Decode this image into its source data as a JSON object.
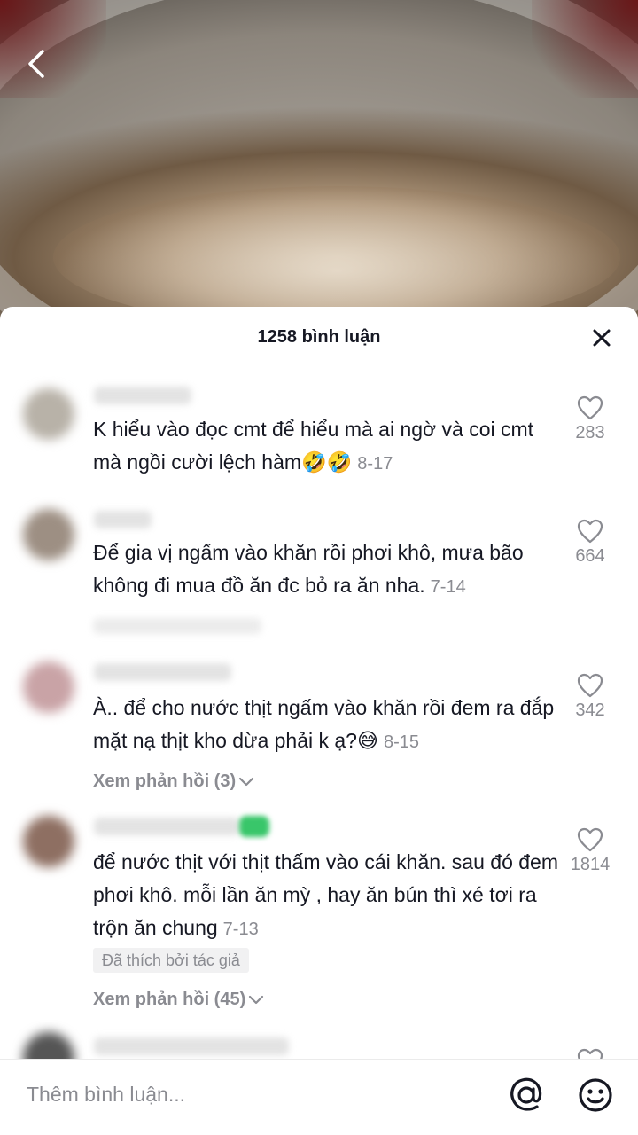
{
  "comments_sheet": {
    "title": "1258 bình luận",
    "close_icon": "close-icon"
  },
  "comments": [
    {
      "text": "K hiểu vào đọc cmt để hiểu mà ai ngờ và coi cmt mà ngồi cười lệch hàm🤣🤣",
      "date": "8-17",
      "likes": "283"
    },
    {
      "text": "Để gia vị ngấm vào khăn rồi phơi khô, mưa bão không đi mua đồ ăn đc bỏ ra ăn nha.",
      "date": "7-14",
      "likes": "664"
    },
    {
      "text": "À.. để cho nước thịt ngấm vào khăn rồi đem ra đắp mặt nạ thịt kho dừa phải k ạ?😅",
      "date": "8-15",
      "likes": "342",
      "replies": "Xem phản hồi (3)"
    },
    {
      "text": "để nước thịt với thịt thấm vào cái khăn. sau đó đem phơi khô. mỗi lần ăn mỳ , hay ăn bún thì xé tơi ra trộn ăn chung",
      "date": "7-13",
      "likes": "1814",
      "badge": "Đã thích bởi tác giả",
      "replies": "Xem phản hồi (45)"
    }
  ],
  "input": {
    "placeholder": "Thêm bình luận..."
  },
  "icons": {
    "back": "chevron-left-icon",
    "like": "heart-icon",
    "mention": "at-sign-icon",
    "emoji": "smiley-icon"
  },
  "colors": {
    "text": "#161823",
    "muted": "#8a8b91",
    "badge_bg": "#f1f1f2"
  }
}
